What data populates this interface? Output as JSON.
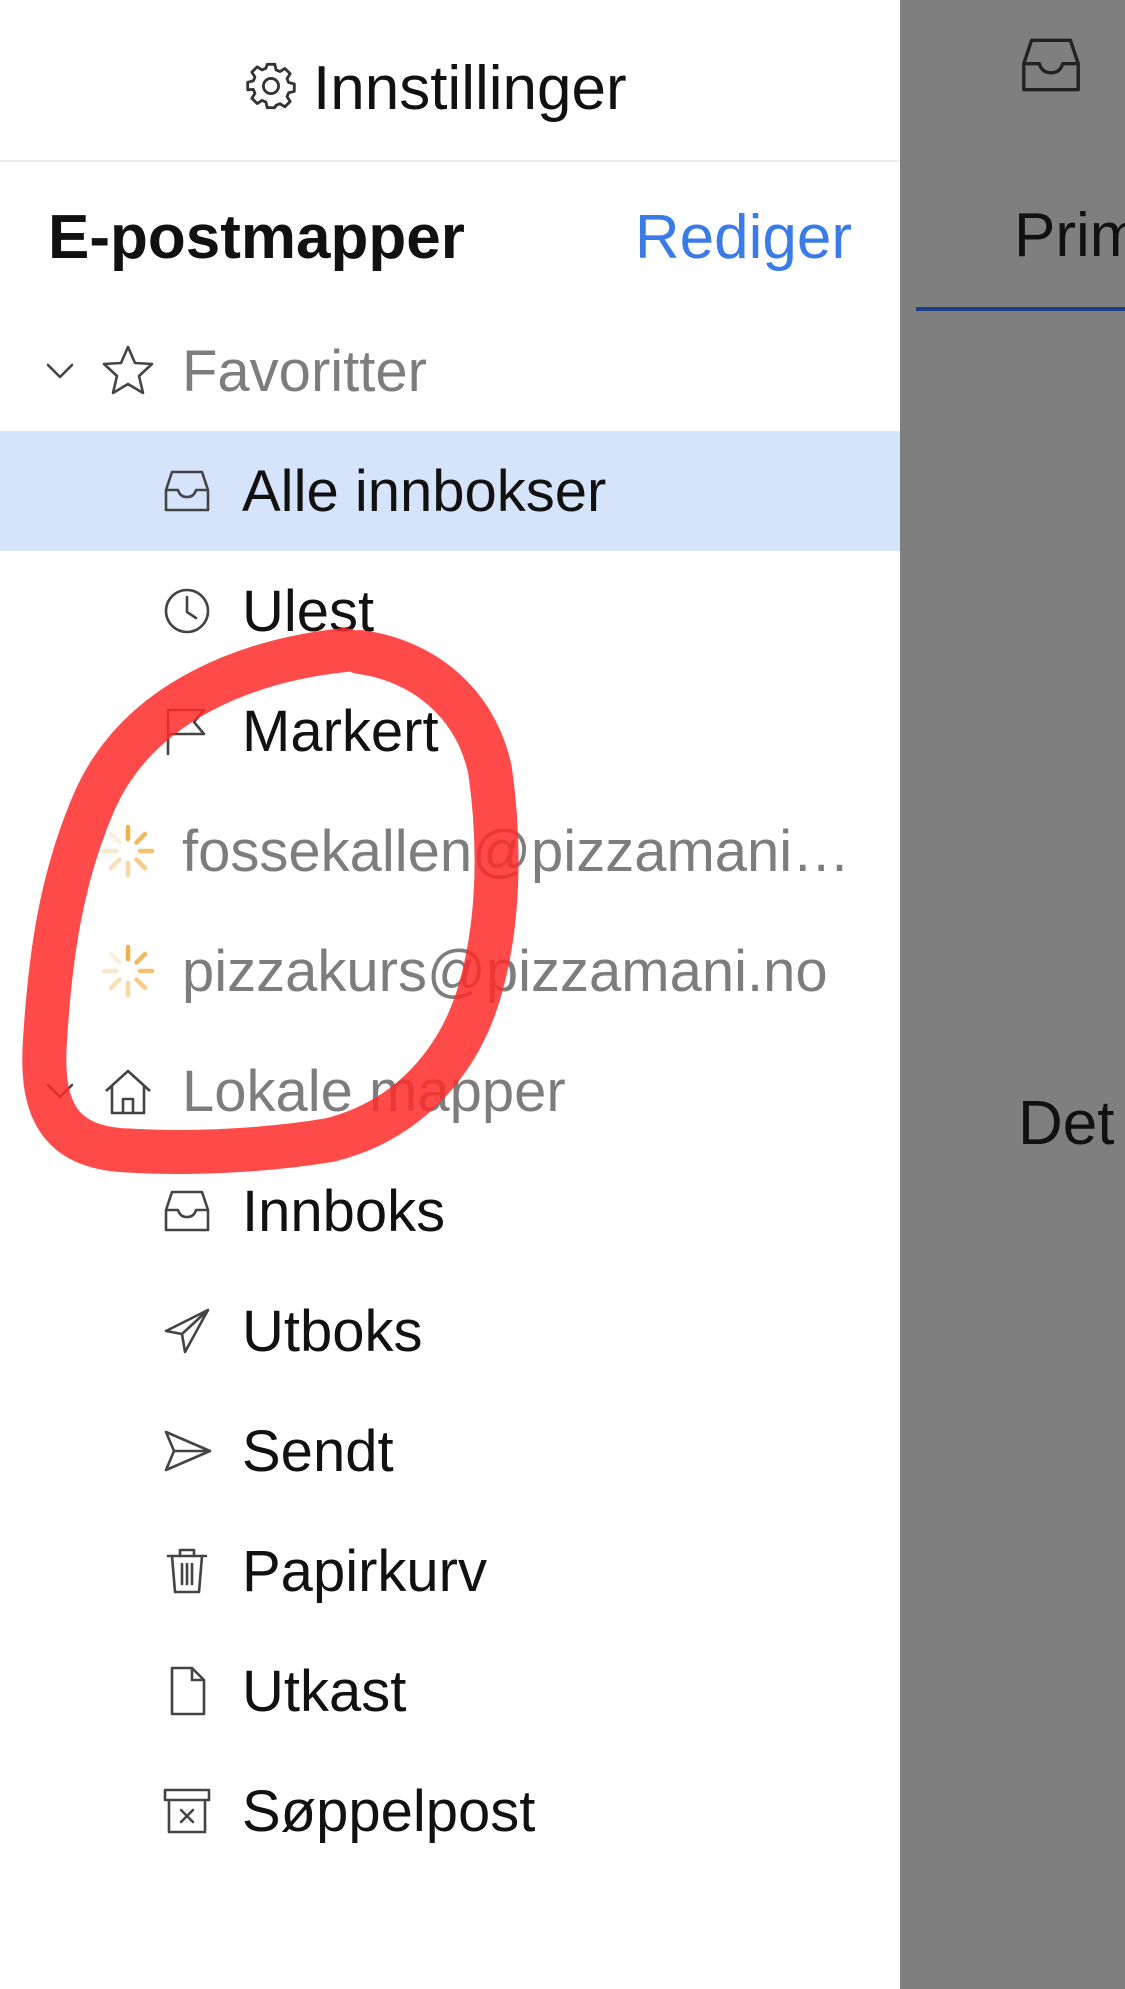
{
  "header": {
    "settings_label": "Innstillinger",
    "settings_icon": "gear-icon"
  },
  "sidebar": {
    "title": "E-postmapper",
    "edit_label": "Rediger",
    "groups": [
      {
        "label": "Favoritter",
        "icon": "star-icon",
        "expanded": true,
        "items": [
          {
            "label": "Alle innbokser",
            "icon": "tray-icon",
            "selected": true
          },
          {
            "label": "Ulest",
            "icon": "clock-icon"
          },
          {
            "label": "Markert",
            "icon": "flag-icon"
          }
        ]
      },
      {
        "label": "Lokale mapper",
        "icon": "home-icon",
        "expanded": true,
        "items": [
          {
            "label": "Innboks",
            "icon": "tray-icon"
          },
          {
            "label": "Utboks",
            "icon": "paper-plane-icon"
          },
          {
            "label": "Sendt",
            "icon": "send-icon"
          },
          {
            "label": "Papirkurv",
            "icon": "trash-icon"
          },
          {
            "label": "Utkast",
            "icon": "document-icon"
          },
          {
            "label": "Søppelpost",
            "icon": "junk-box-icon"
          }
        ]
      }
    ],
    "accounts": [
      {
        "label": "fossekallen@pizzamani…",
        "icon": "loading-spinner-icon"
      },
      {
        "label": "pizzakurs@pizzamani.no",
        "icon": "loading-spinner-icon"
      }
    ]
  },
  "right_pane": {
    "tab_label": "Prim",
    "body_text": "Det"
  },
  "colors": {
    "accent": "#3b7be8",
    "selected_row": "#d5e3fb",
    "spinner": "#f0b14b",
    "overlay": "#7f7f7f",
    "annotation": "#ff2a2a"
  }
}
